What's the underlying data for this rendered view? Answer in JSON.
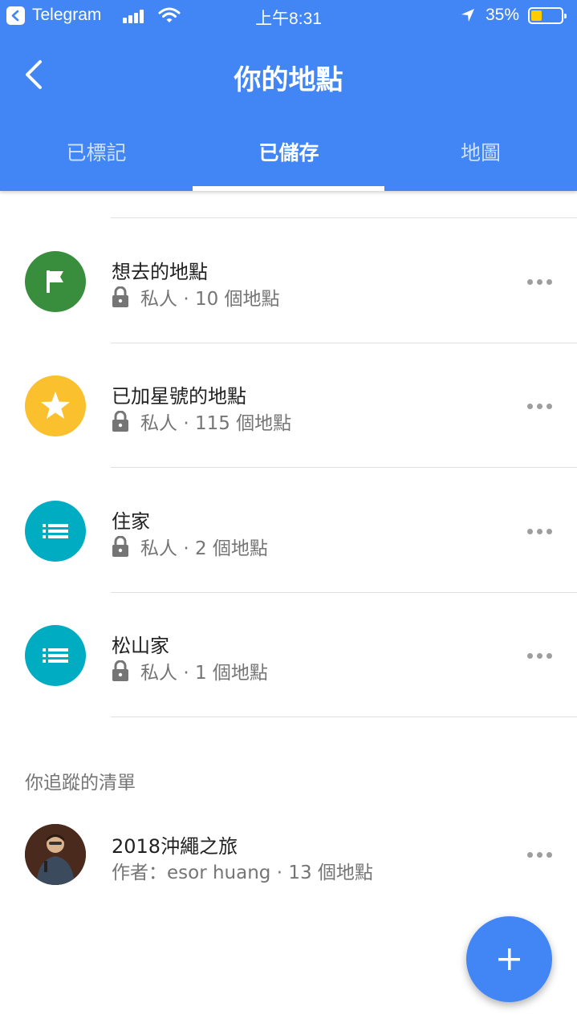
{
  "status_bar": {
    "app_name": "Telegram",
    "time": "上午8:31",
    "battery_percent": "35%",
    "battery_level": 0.35
  },
  "header": {
    "title": "你的地點",
    "tabs": [
      {
        "label": "已標記",
        "active": false
      },
      {
        "label": "已儲存",
        "active": true
      },
      {
        "label": "地圖",
        "active": false
      }
    ]
  },
  "lists": [
    {
      "title": "想去的地點",
      "privacy": "私人",
      "count": "10 個地點",
      "icon": "flag-icon",
      "color": "#388e3c"
    },
    {
      "title": "已加星號的地點",
      "privacy": "私人",
      "count": "115 個地點",
      "icon": "star-icon",
      "color": "#fbc02d"
    },
    {
      "title": "住家",
      "privacy": "私人",
      "count": "2 個地點",
      "icon": "list-icon",
      "color": "#00acc1"
    },
    {
      "title": "松山家",
      "privacy": "私人",
      "count": "1 個地點",
      "icon": "list-icon",
      "color": "#00acc1"
    }
  ],
  "followed": {
    "section_label": "你追蹤的清單",
    "items": [
      {
        "title": "2018沖繩之旅",
        "author_label": "作者：",
        "author": "esor huang",
        "count": "13 個地點"
      }
    ]
  },
  "separator": "·",
  "colors": {
    "primary": "#4286f5",
    "green": "#388e3c",
    "yellow": "#fbc02d",
    "teal": "#00acc1"
  }
}
